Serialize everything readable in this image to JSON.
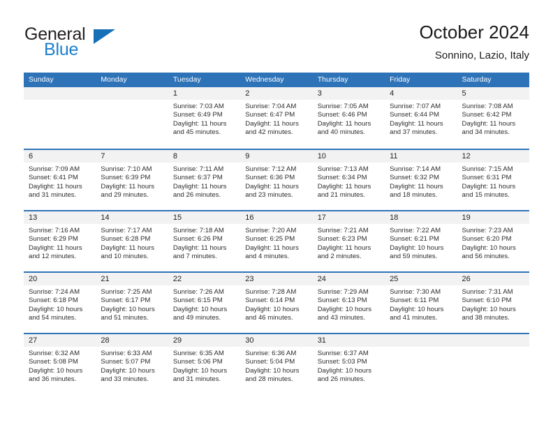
{
  "brand": {
    "name_part1": "General",
    "name_part2": "Blue",
    "triangle_color": "#1670b8",
    "blue_color": "#1a80cf"
  },
  "header": {
    "title": "October 2024",
    "location": "Sonnino, Lazio, Italy"
  },
  "colors": {
    "header_blue": "#2e73b8",
    "daynum_band": "#f2f2f2",
    "text": "#222222"
  },
  "weekday_headers": [
    "Sunday",
    "Monday",
    "Tuesday",
    "Wednesday",
    "Thursday",
    "Friday",
    "Saturday"
  ],
  "weeks": [
    [
      {
        "day": "",
        "sunrise": "",
        "sunset": "",
        "daylight": ""
      },
      {
        "day": "",
        "sunrise": "",
        "sunset": "",
        "daylight": ""
      },
      {
        "day": "1",
        "sunrise": "Sunrise: 7:03 AM",
        "sunset": "Sunset: 6:49 PM",
        "daylight": "Daylight: 11 hours and 45 minutes."
      },
      {
        "day": "2",
        "sunrise": "Sunrise: 7:04 AM",
        "sunset": "Sunset: 6:47 PM",
        "daylight": "Daylight: 11 hours and 42 minutes."
      },
      {
        "day": "3",
        "sunrise": "Sunrise: 7:05 AM",
        "sunset": "Sunset: 6:46 PM",
        "daylight": "Daylight: 11 hours and 40 minutes."
      },
      {
        "day": "4",
        "sunrise": "Sunrise: 7:07 AM",
        "sunset": "Sunset: 6:44 PM",
        "daylight": "Daylight: 11 hours and 37 minutes."
      },
      {
        "day": "5",
        "sunrise": "Sunrise: 7:08 AM",
        "sunset": "Sunset: 6:42 PM",
        "daylight": "Daylight: 11 hours and 34 minutes."
      }
    ],
    [
      {
        "day": "6",
        "sunrise": "Sunrise: 7:09 AM",
        "sunset": "Sunset: 6:41 PM",
        "daylight": "Daylight: 11 hours and 31 minutes."
      },
      {
        "day": "7",
        "sunrise": "Sunrise: 7:10 AM",
        "sunset": "Sunset: 6:39 PM",
        "daylight": "Daylight: 11 hours and 29 minutes."
      },
      {
        "day": "8",
        "sunrise": "Sunrise: 7:11 AM",
        "sunset": "Sunset: 6:37 PM",
        "daylight": "Daylight: 11 hours and 26 minutes."
      },
      {
        "day": "9",
        "sunrise": "Sunrise: 7:12 AM",
        "sunset": "Sunset: 6:36 PM",
        "daylight": "Daylight: 11 hours and 23 minutes."
      },
      {
        "day": "10",
        "sunrise": "Sunrise: 7:13 AM",
        "sunset": "Sunset: 6:34 PM",
        "daylight": "Daylight: 11 hours and 21 minutes."
      },
      {
        "day": "11",
        "sunrise": "Sunrise: 7:14 AM",
        "sunset": "Sunset: 6:32 PM",
        "daylight": "Daylight: 11 hours and 18 minutes."
      },
      {
        "day": "12",
        "sunrise": "Sunrise: 7:15 AM",
        "sunset": "Sunset: 6:31 PM",
        "daylight": "Daylight: 11 hours and 15 minutes."
      }
    ],
    [
      {
        "day": "13",
        "sunrise": "Sunrise: 7:16 AM",
        "sunset": "Sunset: 6:29 PM",
        "daylight": "Daylight: 11 hours and 12 minutes."
      },
      {
        "day": "14",
        "sunrise": "Sunrise: 7:17 AM",
        "sunset": "Sunset: 6:28 PM",
        "daylight": "Daylight: 11 hours and 10 minutes."
      },
      {
        "day": "15",
        "sunrise": "Sunrise: 7:18 AM",
        "sunset": "Sunset: 6:26 PM",
        "daylight": "Daylight: 11 hours and 7 minutes."
      },
      {
        "day": "16",
        "sunrise": "Sunrise: 7:20 AM",
        "sunset": "Sunset: 6:25 PM",
        "daylight": "Daylight: 11 hours and 4 minutes."
      },
      {
        "day": "17",
        "sunrise": "Sunrise: 7:21 AM",
        "sunset": "Sunset: 6:23 PM",
        "daylight": "Daylight: 11 hours and 2 minutes."
      },
      {
        "day": "18",
        "sunrise": "Sunrise: 7:22 AM",
        "sunset": "Sunset: 6:21 PM",
        "daylight": "Daylight: 10 hours and 59 minutes."
      },
      {
        "day": "19",
        "sunrise": "Sunrise: 7:23 AM",
        "sunset": "Sunset: 6:20 PM",
        "daylight": "Daylight: 10 hours and 56 minutes."
      }
    ],
    [
      {
        "day": "20",
        "sunrise": "Sunrise: 7:24 AM",
        "sunset": "Sunset: 6:18 PM",
        "daylight": "Daylight: 10 hours and 54 minutes."
      },
      {
        "day": "21",
        "sunrise": "Sunrise: 7:25 AM",
        "sunset": "Sunset: 6:17 PM",
        "daylight": "Daylight: 10 hours and 51 minutes."
      },
      {
        "day": "22",
        "sunrise": "Sunrise: 7:26 AM",
        "sunset": "Sunset: 6:15 PM",
        "daylight": "Daylight: 10 hours and 49 minutes."
      },
      {
        "day": "23",
        "sunrise": "Sunrise: 7:28 AM",
        "sunset": "Sunset: 6:14 PM",
        "daylight": "Daylight: 10 hours and 46 minutes."
      },
      {
        "day": "24",
        "sunrise": "Sunrise: 7:29 AM",
        "sunset": "Sunset: 6:13 PM",
        "daylight": "Daylight: 10 hours and 43 minutes."
      },
      {
        "day": "25",
        "sunrise": "Sunrise: 7:30 AM",
        "sunset": "Sunset: 6:11 PM",
        "daylight": "Daylight: 10 hours and 41 minutes."
      },
      {
        "day": "26",
        "sunrise": "Sunrise: 7:31 AM",
        "sunset": "Sunset: 6:10 PM",
        "daylight": "Daylight: 10 hours and 38 minutes."
      }
    ],
    [
      {
        "day": "27",
        "sunrise": "Sunrise: 6:32 AM",
        "sunset": "Sunset: 5:08 PM",
        "daylight": "Daylight: 10 hours and 36 minutes."
      },
      {
        "day": "28",
        "sunrise": "Sunrise: 6:33 AM",
        "sunset": "Sunset: 5:07 PM",
        "daylight": "Daylight: 10 hours and 33 minutes."
      },
      {
        "day": "29",
        "sunrise": "Sunrise: 6:35 AM",
        "sunset": "Sunset: 5:06 PM",
        "daylight": "Daylight: 10 hours and 31 minutes."
      },
      {
        "day": "30",
        "sunrise": "Sunrise: 6:36 AM",
        "sunset": "Sunset: 5:04 PM",
        "daylight": "Daylight: 10 hours and 28 minutes."
      },
      {
        "day": "31",
        "sunrise": "Sunrise: 6:37 AM",
        "sunset": "Sunset: 5:03 PM",
        "daylight": "Daylight: 10 hours and 26 minutes."
      },
      {
        "day": "",
        "sunrise": "",
        "sunset": "",
        "daylight": ""
      },
      {
        "day": "",
        "sunrise": "",
        "sunset": "",
        "daylight": ""
      }
    ]
  ]
}
